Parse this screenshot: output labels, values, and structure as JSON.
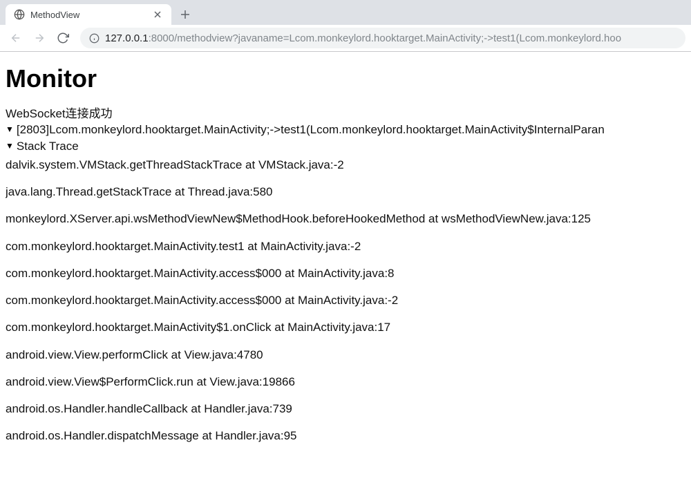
{
  "browser": {
    "tab": {
      "title": "MethodView"
    },
    "url": {
      "host": "127.0.0.1",
      "port": ":8000",
      "path": "/methodview?javaname=Lcom.monkeylord.hooktarget.MainActivity;->test1(Lcom.monkeylord.hoo"
    }
  },
  "page": {
    "heading": "Monitor",
    "ws_status": "WebSocket连接成功",
    "collapsible1": "[2803]Lcom.monkeylord.hooktarget.MainActivity;->test1(Lcom.monkeylord.hooktarget.MainActivity$InternalParan",
    "collapsible2": "Stack Trace",
    "stack": [
      "dalvik.system.VMStack.getThreadStackTrace at VMStack.java:-2",
      "java.lang.Thread.getStackTrace at Thread.java:580",
      "monkeylord.XServer.api.wsMethodViewNew$MethodHook.beforeHookedMethod at wsMethodViewNew.java:125",
      "com.monkeylord.hooktarget.MainActivity.test1 at MainActivity.java:-2",
      "com.monkeylord.hooktarget.MainActivity.access$000 at MainActivity.java:8",
      "com.monkeylord.hooktarget.MainActivity.access$000 at MainActivity.java:-2",
      "com.monkeylord.hooktarget.MainActivity$1.onClick at MainActivity.java:17",
      "android.view.View.performClick at View.java:4780",
      "android.view.View$PerformClick.run at View.java:19866",
      "android.os.Handler.handleCallback at Handler.java:739",
      "android.os.Handler.dispatchMessage at Handler.java:95"
    ]
  }
}
